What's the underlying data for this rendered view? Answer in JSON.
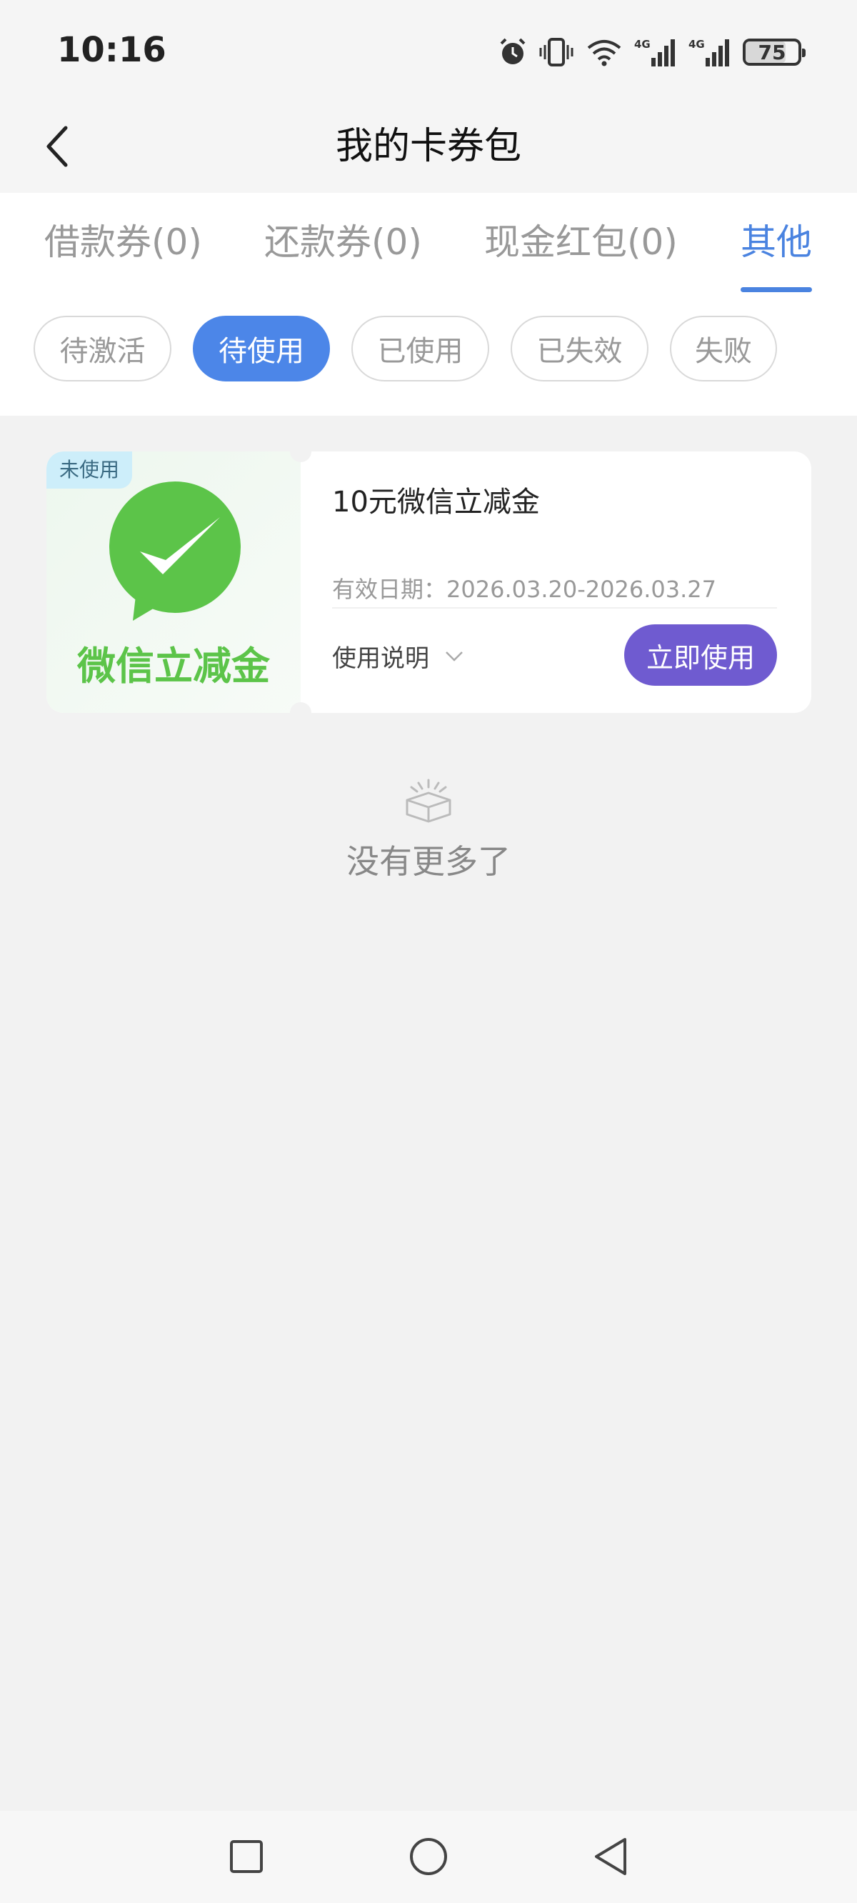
{
  "status_bar": {
    "time": "10:16",
    "icons": [
      "alarm-icon",
      "vibrate-icon",
      "wifi-icon",
      "signal-4g-icon",
      "signal-4g-icon"
    ],
    "battery_level": "75"
  },
  "header": {
    "title": "我的卡券包",
    "back_icon": "chevron-left-icon"
  },
  "tabs": [
    {
      "label": "借款券(0)",
      "active": false
    },
    {
      "label": "还款券(0)",
      "active": false
    },
    {
      "label": "现金红包(0)",
      "active": false
    },
    {
      "label": "其他",
      "active": true
    }
  ],
  "filters": [
    {
      "label": "待激活",
      "active": false
    },
    {
      "label": "待使用",
      "active": true
    },
    {
      "label": "已使用",
      "active": false
    },
    {
      "label": "已失效",
      "active": false
    },
    {
      "label": "失败",
      "active": false
    }
  ],
  "coupon": {
    "status_tag": "未使用",
    "brand_label": "微信立减金",
    "title": "10元微信立减金",
    "validity": "有效日期：2026.03.20-2026.03.27",
    "instructions_label": "使用说明",
    "use_button": "立即使用",
    "colors": {
      "brand_green": "#5cc449",
      "button_purple": "#6f5bd0"
    }
  },
  "empty_hint": {
    "text": "没有更多了",
    "icon": "empty-box-icon"
  },
  "nav_bar": {
    "icons": [
      "square-recents-icon",
      "circle-home-icon",
      "triangle-back-icon"
    ]
  },
  "theme": {
    "accent": "#4a83e0"
  }
}
